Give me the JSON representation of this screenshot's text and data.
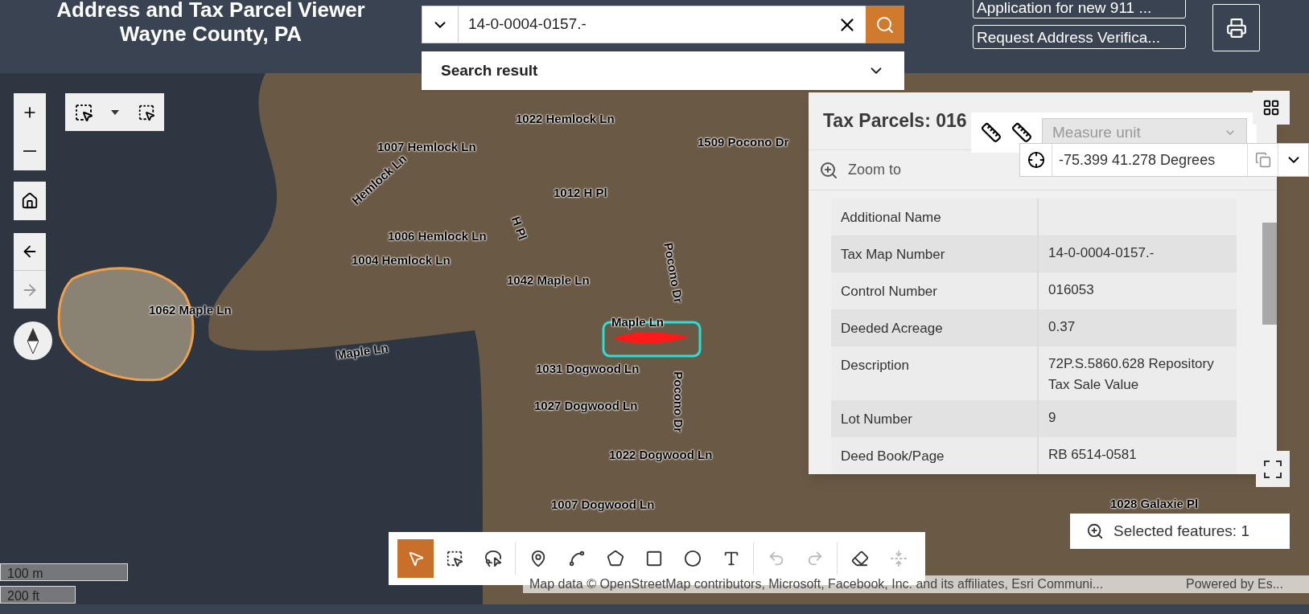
{
  "header": {
    "title_lines": [
      "Address and Tax Parcel Viewer",
      "Wayne County, PA"
    ],
    "search": {
      "value": "14-0-0004-0157.-",
      "result_label": "Search result"
    },
    "buttons": [
      "Application for new 911 ...",
      "Request Address Verifica..."
    ]
  },
  "map": {
    "labels": [
      {
        "text": "1022 Hemlock Ln"
      },
      {
        "text": "1007 Hemlock Ln"
      },
      {
        "text": "1509 Pocono Dr"
      },
      {
        "text": "1012 H Pl"
      },
      {
        "text": "1006 Hemlock Ln"
      },
      {
        "text": "1004 Hemlock Ln"
      },
      {
        "text": "1042 Maple Ln"
      },
      {
        "text": "1062 Maple Ln"
      },
      {
        "text": "Maple Ln"
      },
      {
        "text": "1031 Dogwood Ln"
      },
      {
        "text": "1027 Dogwood Ln"
      },
      {
        "text": "1022 Dogwood Ln"
      },
      {
        "text": "1007 Dogwood Ln"
      },
      {
        "text": "1028 Galaxie Pl"
      },
      {
        "text": "Maple Ln"
      },
      {
        "text": "Pocono Dr"
      },
      {
        "text": "Pocono Dr"
      },
      {
        "text": "Hemlock Ln"
      },
      {
        "text": "H Pl"
      }
    ],
    "scale": [
      "100 m",
      "200 ft"
    ],
    "attribution": "Map data © OpenStreetMap contributors, Microsoft, Facebook, Inc. and its affiliates, Esri Communi...",
    "powered_by": "Powered by Es...",
    "selected_features": "Selected features: 1"
  },
  "popup": {
    "title": "Tax Parcels: 016",
    "zoom_to": "Zoom to",
    "rows": [
      {
        "label": "Additional Name"
      },
      {
        "label": "Tax Map Number",
        "value": "14-0-0004-0157.-"
      },
      {
        "label": "Control Number",
        "value": "016053"
      },
      {
        "label": "Deeded Acreage",
        "value": "0.37"
      },
      {
        "label": "Description",
        "value": "72P.S.5860.628 Repository Tax Sale Value"
      },
      {
        "label": "Lot Number",
        "value": "9"
      },
      {
        "label": "Deed Book/Page",
        "value": "RB 6514-0581"
      }
    ]
  },
  "measure": {
    "unit_placeholder": "Measure unit",
    "coordinates": "-75.399 41.278 Degrees"
  },
  "toolbar": [
    {
      "kind": "select",
      "selected": true,
      "disabled": false
    },
    {
      "kind": "rect-select",
      "selected": false,
      "disabled": false
    },
    {
      "kind": "lasso",
      "selected": false,
      "disabled": false
    },
    {
      "kind": "point",
      "selected": false,
      "disabled": false
    },
    {
      "kind": "polyline",
      "selected": false,
      "disabled": false
    },
    {
      "kind": "polygon",
      "selected": false,
      "disabled": false
    },
    {
      "kind": "rectangle",
      "selected": false,
      "disabled": false
    },
    {
      "kind": "circle",
      "selected": false,
      "disabled": false
    },
    {
      "kind": "text",
      "selected": false,
      "disabled": false
    },
    {
      "kind": "undo",
      "selected": false,
      "disabled": true
    },
    {
      "kind": "redo",
      "selected": false,
      "disabled": true
    },
    {
      "kind": "erase",
      "selected": false,
      "disabled": false
    },
    {
      "kind": "collapse",
      "selected": false,
      "disabled": true
    }
  ]
}
